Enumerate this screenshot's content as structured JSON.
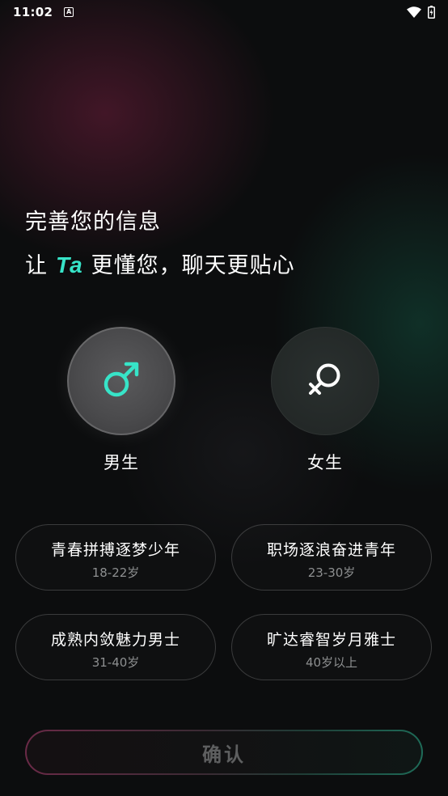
{
  "status_bar": {
    "time": "11:02",
    "notification_icon": "a-app-icon",
    "wifi_icon": "wifi-icon",
    "battery_icon": "battery-charging-icon"
  },
  "header": {
    "title": "完善您的信息",
    "subtitle_prefix": "让",
    "subtitle_ta": "Ta",
    "subtitle_suffix": "更懂您，聊天更贴心"
  },
  "gender": {
    "male": {
      "label": "男生",
      "icon": "male-symbol-icon",
      "selected": true
    },
    "female": {
      "label": "女生",
      "icon": "female-symbol-icon",
      "selected": false
    }
  },
  "age_options": [
    {
      "title": "青春拼搏逐梦少年",
      "range": "18-22岁"
    },
    {
      "title": "职场逐浪奋进青年",
      "range": "23-30岁"
    },
    {
      "title": "成熟内敛魅力男士",
      "range": "31-40岁"
    },
    {
      "title": "旷达睿智岁月雅士",
      "range": "40岁以上"
    }
  ],
  "confirm": {
    "label": "确认"
  },
  "colors": {
    "accent": "#37e4c8",
    "background": "#0c0d0e",
    "muted_text": "#8d8f90"
  }
}
